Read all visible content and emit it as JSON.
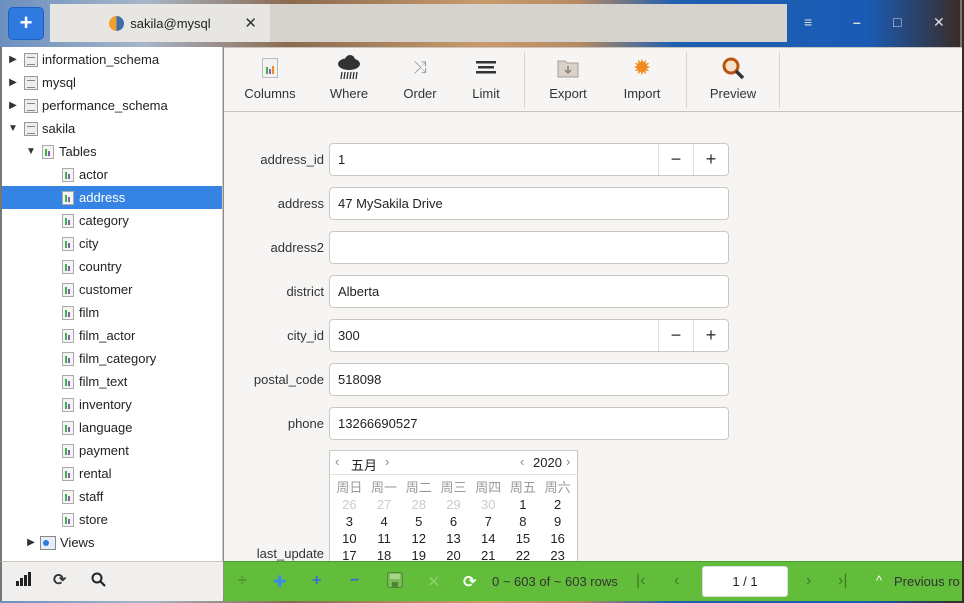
{
  "titlebar": {
    "new_button": "+",
    "tab_title": "sakila@mysql",
    "tab_close": "✕",
    "menu": "≡",
    "minimize": "–",
    "maximize": "□",
    "close": "✕"
  },
  "sidebar": {
    "databases": [
      {
        "label": "information_schema",
        "expanded": false
      },
      {
        "label": "mysql",
        "expanded": false
      },
      {
        "label": "performance_schema",
        "expanded": false
      },
      {
        "label": "sakila",
        "expanded": true
      }
    ],
    "tables_folder": "Tables",
    "tables": [
      "actor",
      "address",
      "category",
      "city",
      "country",
      "customer",
      "film",
      "film_actor",
      "film_category",
      "film_text",
      "inventory",
      "language",
      "payment",
      "rental",
      "staff",
      "store"
    ],
    "selected_table": "address",
    "views_folder": "Views",
    "footer_icons": [
      "signal-icon",
      "refresh-icon",
      "search-icon"
    ]
  },
  "toolbar": {
    "buttons": [
      {
        "label": "Columns",
        "icon": "columns-icon"
      },
      {
        "label": "Where",
        "icon": "where-icon"
      },
      {
        "label": "Order",
        "icon": "order-icon"
      },
      {
        "label": "Limit",
        "icon": "limit-icon"
      },
      {
        "label": "Export",
        "icon": "export-icon"
      },
      {
        "label": "Import",
        "icon": "import-icon"
      },
      {
        "label": "Preview",
        "icon": "preview-icon"
      }
    ]
  },
  "form": {
    "fields": [
      {
        "label": "address_id",
        "value": "1",
        "type": "spin"
      },
      {
        "label": "address",
        "value": "47 MySakila Drive",
        "type": "text"
      },
      {
        "label": "address2",
        "value": "",
        "type": "text"
      },
      {
        "label": "district",
        "value": "Alberta",
        "type": "text"
      },
      {
        "label": "city_id",
        "value": "300",
        "type": "spin"
      },
      {
        "label": "postal_code",
        "value": "518098",
        "type": "text"
      },
      {
        "label": "phone",
        "value": "13266690527",
        "type": "text"
      }
    ],
    "spin_minus": "−",
    "spin_plus": "+",
    "last_update_label": "last_update",
    "calendar": {
      "month": "五月",
      "year": "2020",
      "prev": "‹",
      "next": "›",
      "weekdays": [
        "周日",
        "周一",
        "周二",
        "周三",
        "周四",
        "周五",
        "周六"
      ],
      "days": [
        [
          "26",
          "27",
          "28",
          "29",
          "30",
          "1",
          "2"
        ],
        [
          "3",
          "4",
          "5",
          "6",
          "7",
          "8",
          "9"
        ],
        [
          "10",
          "11",
          "12",
          "13",
          "14",
          "15",
          "16"
        ],
        [
          "17",
          "18",
          "19",
          "20",
          "21",
          "22",
          "23"
        ]
      ],
      "outside_month_first_row": 5
    }
  },
  "statusbar": {
    "row_info": "0 ~ 603 of ~ 603 rows",
    "page": "1 / 1",
    "previous_row": "Previous ro"
  }
}
